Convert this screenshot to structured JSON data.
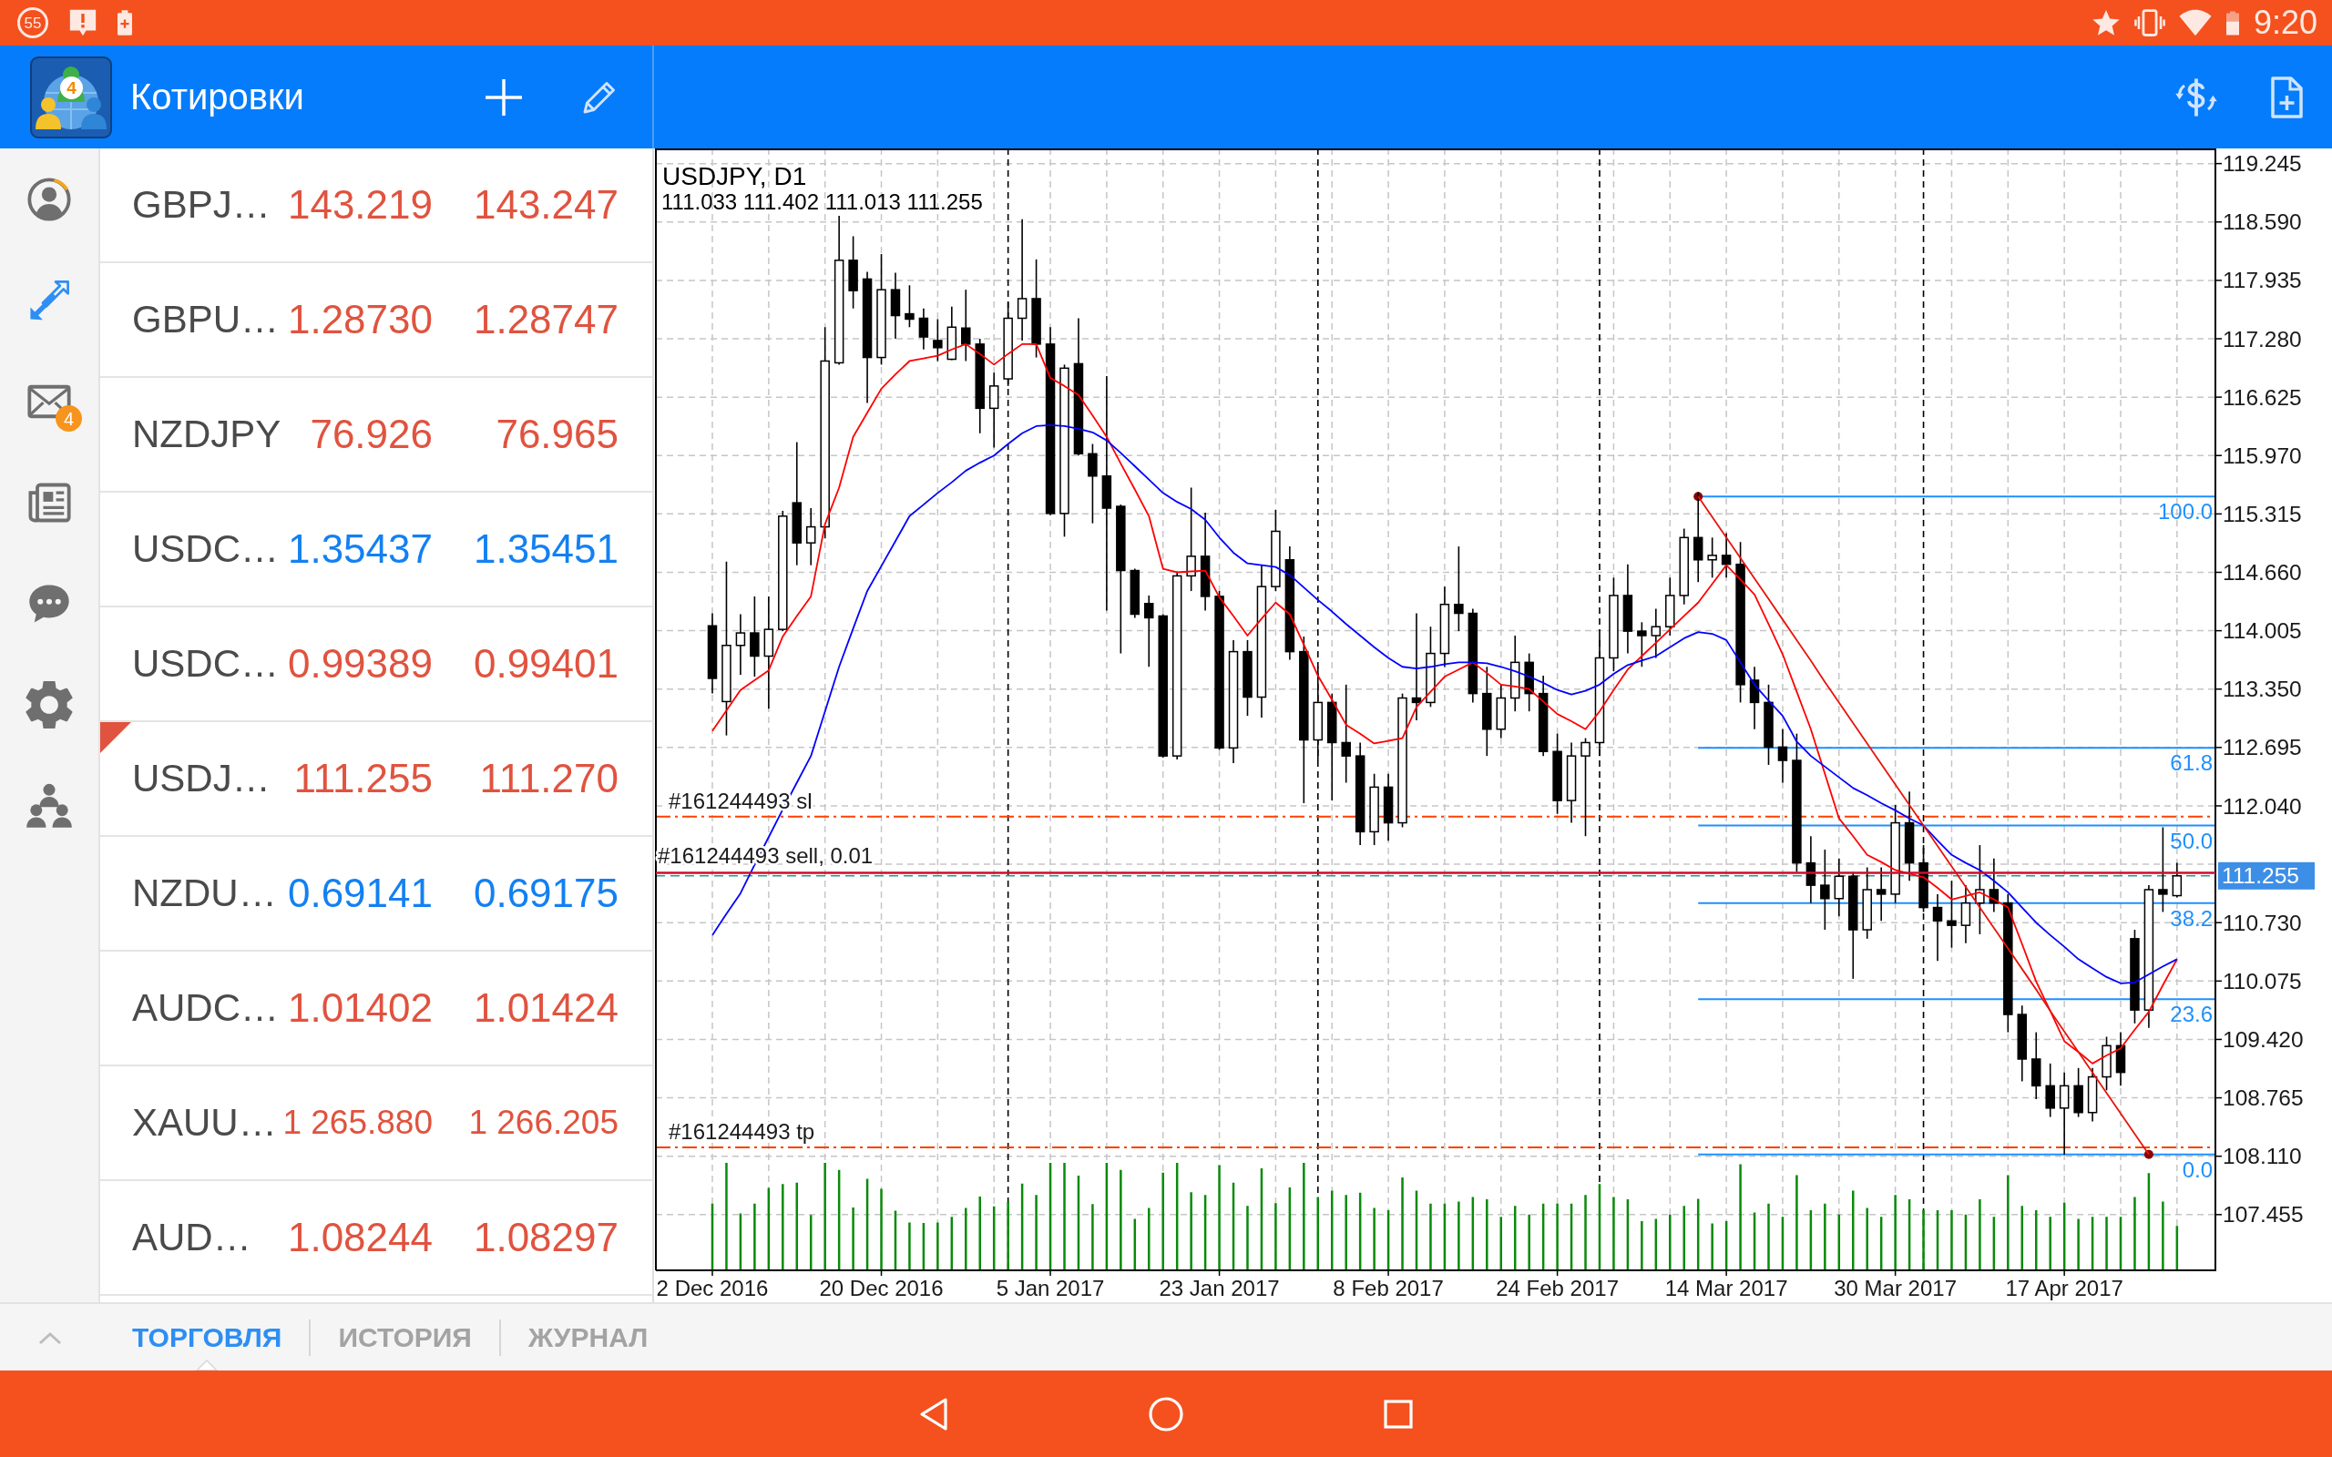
{
  "status_bar": {
    "notification_count": "55",
    "time": "9:20"
  },
  "app_bar": {
    "logo_badge": "4",
    "title": "Котировки"
  },
  "sidebar": {
    "items": [
      {
        "selected": false
      },
      {
        "selected": true
      },
      {
        "selected": false,
        "badge": "4"
      },
      {
        "selected": false
      },
      {
        "selected": false
      },
      {
        "selected": false
      },
      {
        "selected": false
      }
    ]
  },
  "quotes": [
    {
      "symbol": "GBPJ…",
      "bid": "143.219",
      "ask": "143.247",
      "color": "#e0533f",
      "selected": false
    },
    {
      "symbol": "GBPU…",
      "bid": "1.28730",
      "ask": "1.28747",
      "color": "#e0533f",
      "selected": false
    },
    {
      "symbol": "NZDJPY",
      "bid": "76.926",
      "ask": "76.965",
      "color": "#e0533f",
      "selected": false
    },
    {
      "symbol": "USDC…",
      "bid": "1.35437",
      "ask": "1.35451",
      "color": "#1380f2",
      "selected": false
    },
    {
      "symbol": "USDC…",
      "bid": "0.99389",
      "ask": "0.99401",
      "color": "#e0533f",
      "selected": false
    },
    {
      "symbol": "USDJ…",
      "bid": "111.255",
      "ask": "111.270",
      "color": "#e0533f",
      "selected": true
    },
    {
      "symbol": "NZDU…",
      "bid": "0.69141",
      "ask": "0.69175",
      "color": "#1380f2",
      "selected": false
    },
    {
      "symbol": "AUDC…",
      "bid": "1.01402",
      "ask": "1.01424",
      "color": "#e0533f",
      "selected": false
    },
    {
      "symbol": "XAUU…",
      "bid": "1 265.880",
      "ask": "1 266.205",
      "color": "#e0533f",
      "selected": false
    },
    {
      "symbol": "AUD…",
      "bid": "1.08244",
      "ask": "1.08297",
      "color": "#e0533f",
      "selected": false
    }
  ],
  "chart": {
    "chart_data": [
      {
        "type": "candlestick",
        "title": "USDJPY, D1",
        "subtitle": "111.033 111.402 111.013 111.255",
        "categories": [
          "2 Dec 2016",
          null,
          null,
          null,
          null,
          null,
          null,
          null,
          null,
          null,
          null,
          null,
          "20 Dec 2016",
          null,
          null,
          null,
          null,
          null,
          null,
          null,
          null,
          null,
          null,
          null,
          "5 Jan 2017",
          null,
          null,
          null,
          null,
          null,
          null,
          null,
          null,
          null,
          null,
          null,
          "23 Jan 2017",
          null,
          null,
          null,
          null,
          null,
          null,
          null,
          null,
          null,
          null,
          null,
          "8 Feb 2017",
          null,
          null,
          null,
          null,
          null,
          null,
          null,
          null,
          null,
          null,
          null,
          "24 Feb 2017",
          null,
          null,
          null,
          null,
          null,
          null,
          null,
          null,
          null,
          null,
          null,
          "14 Mar 2017",
          null,
          null,
          null,
          null,
          null,
          null,
          null,
          null,
          null,
          null,
          null,
          "30 Mar 2017",
          null,
          null,
          null,
          null,
          null,
          null,
          null,
          null,
          null,
          null,
          null,
          "17 Apr 2017",
          null,
          null,
          null,
          null,
          null,
          null,
          null,
          null,
          null,
          null
        ],
        "ohlc": [
          [
            114.06,
            114.2,
            113.3,
            113.47
          ],
          [
            113.21,
            114.78,
            112.83,
            113.84
          ],
          [
            113.84,
            114.19,
            113.51,
            113.98
          ],
          [
            113.98,
            114.39,
            113.49,
            113.72
          ],
          [
            113.72,
            114.39,
            113.13,
            114.02
          ],
          [
            114.02,
            115.35,
            114.0,
            115.29
          ],
          [
            115.44,
            116.12,
            114.74,
            114.99
          ],
          [
            114.99,
            115.38,
            114.74,
            115.17
          ],
          [
            115.17,
            117.41,
            115.04,
            117.03
          ],
          [
            117.01,
            118.66,
            116.99,
            118.16
          ],
          [
            118.16,
            118.43,
            117.62,
            117.82
          ],
          [
            117.95,
            118.03,
            116.56,
            117.07
          ],
          [
            117.07,
            118.23,
            116.99,
            117.83
          ],
          [
            117.83,
            118.02,
            117.28,
            117.54
          ],
          [
            117.56,
            117.88,
            117.41,
            117.5
          ],
          [
            117.51,
            117.62,
            117.16,
            117.3
          ],
          [
            117.26,
            117.5,
            117.03,
            117.18
          ],
          [
            117.05,
            117.64,
            117.04,
            117.41
          ],
          [
            117.4,
            117.83,
            117.03,
            117.22
          ],
          [
            117.22,
            117.28,
            116.22,
            116.5
          ],
          [
            116.5,
            116.9,
            116.06,
            116.75
          ],
          [
            116.83,
            117.69,
            116.75,
            117.51
          ],
          [
            117.51,
            118.62,
            117.26,
            117.73
          ],
          [
            117.73,
            118.17,
            117.07,
            117.22
          ],
          [
            117.22,
            117.41,
            115.3,
            115.32
          ],
          [
            115.32,
            116.99,
            115.06,
            116.95
          ],
          [
            117.0,
            117.51,
            115.97,
            115.99
          ],
          [
            115.99,
            116.1,
            115.21,
            115.74
          ],
          [
            115.74,
            116.86,
            114.23,
            115.38
          ],
          [
            115.4,
            115.42,
            113.75,
            114.68
          ],
          [
            114.68,
            114.7,
            114.15,
            114.19
          ],
          [
            114.31,
            114.4,
            113.6,
            114.15
          ],
          [
            114.17,
            114.19,
            112.58,
            112.6
          ],
          [
            112.6,
            114.67,
            112.56,
            114.62
          ],
          [
            114.62,
            115.61,
            114.45,
            114.84
          ],
          [
            114.84,
            115.33,
            114.23,
            114.39
          ],
          [
            114.39,
            114.45,
            112.67,
            112.69
          ],
          [
            112.69,
            113.9,
            112.52,
            113.77
          ],
          [
            113.77,
            113.9,
            113.05,
            113.26
          ],
          [
            113.26,
            114.74,
            113.03,
            114.5
          ],
          [
            114.5,
            115.36,
            114.45,
            115.12
          ],
          [
            114.8,
            114.95,
            113.68,
            113.77
          ],
          [
            113.77,
            113.94,
            112.07,
            112.78
          ],
          [
            112.78,
            113.6,
            112.55,
            113.2
          ],
          [
            113.2,
            113.3,
            112.1,
            112.75
          ],
          [
            112.75,
            113.4,
            112.3,
            112.6
          ],
          [
            112.6,
            112.75,
            111.6,
            111.75
          ],
          [
            111.75,
            112.4,
            111.6,
            112.25
          ],
          [
            112.25,
            112.4,
            111.65,
            111.85
          ],
          [
            111.85,
            113.3,
            111.8,
            113.25
          ],
          [
            113.25,
            114.2,
            113.0,
            113.2
          ],
          [
            113.2,
            114.05,
            113.15,
            113.75
          ],
          [
            113.75,
            114.5,
            113.6,
            114.3
          ],
          [
            114.3,
            114.95,
            114.0,
            114.2
          ],
          [
            114.2,
            114.25,
            113.2,
            113.3
          ],
          [
            113.3,
            113.6,
            112.6,
            112.9
          ],
          [
            112.9,
            113.4,
            112.8,
            113.25
          ],
          [
            113.25,
            113.95,
            113.1,
            113.65
          ],
          [
            113.65,
            113.75,
            113.1,
            113.3
          ],
          [
            113.3,
            113.5,
            112.6,
            112.65
          ],
          [
            112.65,
            112.85,
            111.95,
            112.1
          ],
          [
            112.1,
            112.75,
            111.85,
            112.6
          ],
          [
            112.6,
            112.8,
            111.7,
            112.75
          ],
          [
            112.75,
            113.95,
            112.6,
            113.7
          ],
          [
            113.7,
            114.6,
            113.55,
            114.4
          ],
          [
            114.4,
            114.75,
            113.75,
            114.0
          ],
          [
            114.0,
            114.1,
            113.6,
            113.95
          ],
          [
            113.95,
            114.25,
            113.7,
            114.05
          ],
          [
            114.05,
            114.6,
            113.95,
            114.4
          ],
          [
            114.4,
            115.15,
            114.3,
            115.05
          ],
          [
            115.05,
            115.56,
            114.55,
            114.8
          ],
          [
            114.8,
            115.05,
            114.6,
            114.85
          ],
          [
            114.85,
            115.1,
            114.6,
            114.75
          ],
          [
            114.75,
            115.0,
            113.2,
            113.4
          ],
          [
            113.45,
            113.6,
            112.9,
            113.2
          ],
          [
            113.2,
            113.4,
            112.5,
            112.7
          ],
          [
            112.7,
            112.9,
            112.3,
            112.55
          ],
          [
            112.55,
            112.85,
            111.3,
            111.4
          ],
          [
            111.4,
            111.7,
            110.95,
            111.15
          ],
          [
            111.15,
            111.55,
            110.65,
            111.0
          ],
          [
            111.0,
            111.45,
            110.8,
            111.25
          ],
          [
            111.25,
            111.3,
            110.1,
            110.65
          ],
          [
            110.65,
            111.35,
            110.55,
            111.1
          ],
          [
            111.1,
            111.35,
            110.75,
            111.05
          ],
          [
            111.05,
            112.05,
            110.95,
            111.85
          ],
          [
            111.85,
            112.2,
            111.2,
            111.4
          ],
          [
            111.4,
            111.6,
            110.85,
            110.9
          ],
          [
            110.9,
            111.05,
            110.3,
            110.75
          ],
          [
            110.75,
            111.2,
            110.45,
            110.7
          ],
          [
            110.7,
            111.15,
            110.5,
            110.95
          ],
          [
            110.95,
            111.6,
            110.6,
            111.1
          ],
          [
            111.1,
            111.45,
            110.85,
            110.95
          ],
          [
            110.95,
            111.05,
            109.5,
            109.7
          ],
          [
            109.7,
            109.8,
            108.95,
            109.2
          ],
          [
            109.2,
            109.5,
            108.75,
            108.9
          ],
          [
            108.9,
            109.15,
            108.55,
            108.65
          ],
          [
            108.65,
            109.05,
            108.13,
            108.9
          ],
          [
            108.9,
            109.1,
            108.55,
            108.6
          ],
          [
            108.6,
            109.1,
            108.5,
            109.0
          ],
          [
            109.0,
            109.45,
            108.85,
            109.35
          ],
          [
            109.35,
            109.5,
            108.9,
            109.05
          ],
          [
            110.55,
            110.65,
            109.6,
            109.75
          ],
          [
            109.75,
            111.15,
            109.55,
            111.1
          ],
          [
            111.1,
            111.8,
            110.85,
            111.05
          ],
          [
            111.033,
            111.402,
            111.013,
            111.255
          ],
          null,
          null
        ],
        "series": [
          {
            "type": "line",
            "color": "#ff0000",
            "values": [
              112.88,
              113.11,
              113.34,
              113.45,
              113.56,
              113.94,
              114.17,
              114.39,
              115.2,
              115.61,
              116.18,
              116.45,
              116.72,
              116.88,
              117.03,
              117.06,
              117.09,
              117.16,
              117.22,
              117.11,
              116.99,
              117.11,
              117.22,
              117.22,
              116.84,
              116.75,
              116.65,
              116.42,
              116.18,
              115.88,
              115.59,
              115.29,
              114.7,
              114.66,
              114.67,
              114.68,
              114.38,
              114.17,
              113.95,
              114.14,
              114.32,
              114.19,
              113.85,
              113.5,
              113.23,
              112.95,
              112.85,
              112.74,
              112.77,
              112.8,
              113.15,
              113.32,
              113.49,
              113.57,
              113.65,
              113.53,
              113.4,
              113.38,
              113.35,
              113.21,
              113.07,
              112.99,
              112.9,
              113.1,
              113.34,
              113.57,
              113.72,
              113.87,
              114.02,
              114.17,
              114.32,
              114.53,
              114.74,
              114.58,
              114.41,
              114.08,
              113.74,
              113.32,
              112.9,
              112.4,
              111.9,
              111.7,
              111.49,
              111.41,
              111.32,
              111.28,
              111.24,
              111.12,
              110.99,
              111.03,
              111.07,
              110.99,
              110.9,
              110.49,
              110.07,
              109.74,
              109.4,
              109.28,
              109.15,
              109.24,
              109.32,
              109.53,
              109.73,
              110.03,
              110.32,
              null,
              null
            ]
          },
          {
            "type": "line",
            "color": "#0000ff",
            "values": [
              110.59,
              110.83,
              111.06,
              111.38,
              111.69,
              112.0,
              112.3,
              112.6,
              113.1,
              113.6,
              114.03,
              114.45,
              114.73,
              115.01,
              115.29,
              115.42,
              115.55,
              115.67,
              115.8,
              115.89,
              115.97,
              116.1,
              116.22,
              116.3,
              116.31,
              116.3,
              116.27,
              116.23,
              116.14,
              116.0,
              115.85,
              115.7,
              115.55,
              115.45,
              115.37,
              115.25,
              115.05,
              114.88,
              114.76,
              114.74,
              114.72,
              114.63,
              114.49,
              114.35,
              114.22,
              114.08,
              113.95,
              113.82,
              113.7,
              113.6,
              113.58,
              113.6,
              113.63,
              113.65,
              113.65,
              113.64,
              113.6,
              113.55,
              113.49,
              113.42,
              113.34,
              113.29,
              113.33,
              113.4,
              113.52,
              113.62,
              113.67,
              113.72,
              113.82,
              113.92,
              113.99,
              113.97,
              113.9,
              113.65,
              113.4,
              113.22,
              113.05,
              112.76,
              112.6,
              112.48,
              112.36,
              112.24,
              112.16,
              112.07,
              111.99,
              111.9,
              111.82,
              111.65,
              111.49,
              111.4,
              111.32,
              111.2,
              111.07,
              110.9,
              110.73,
              110.59,
              110.46,
              110.32,
              110.22,
              110.12,
              110.05,
              110.06,
              110.15,
              110.24,
              110.32,
              null,
              null
            ]
          },
          {
            "type": "line",
            "color": "#e8140c",
            "values": [
              null,
              null,
              null,
              null,
              null,
              null,
              null,
              null,
              null,
              null,
              null,
              null,
              null,
              null,
              null,
              null,
              null,
              null,
              null,
              null,
              null,
              null,
              null,
              null,
              null,
              null,
              null,
              null,
              null,
              null,
              null,
              null,
              null,
              null,
              null,
              null,
              null,
              null,
              null,
              null,
              null,
              null,
              null,
              null,
              null,
              null,
              null,
              null,
              null,
              null,
              null,
              null,
              null,
              null,
              null,
              null,
              null,
              null,
              null,
              null,
              null,
              null,
              null,
              null,
              null,
              null,
              null,
              null,
              null,
              null,
              115.51,
              115.28,
              115.05,
              114.82,
              114.59,
              114.36,
              114.13,
              113.9,
              113.67,
              113.43,
              113.2,
              112.97,
              112.74,
              112.51,
              112.28,
              112.05,
              111.82,
              111.59,
              111.36,
              111.13,
              110.9,
              110.67,
              110.44,
              110.21,
              109.98,
              109.74,
              109.51,
              109.28,
              109.05,
              108.82,
              108.59,
              108.36,
              108.13,
              null,
              null,
              null,
              null
            ]
          },
          {
            "type": "scatter",
            "color": "#8a0000",
            "values": [
              null,
              null,
              null,
              null,
              null,
              null,
              null,
              null,
              null,
              null,
              null,
              null,
              null,
              null,
              null,
              null,
              null,
              null,
              null,
              null,
              null,
              null,
              null,
              null,
              null,
              null,
              null,
              null,
              null,
              null,
              null,
              null,
              null,
              null,
              null,
              null,
              null,
              null,
              null,
              null,
              null,
              null,
              null,
              null,
              null,
              null,
              null,
              null,
              null,
              null,
              null,
              null,
              null,
              null,
              null,
              null,
              null,
              null,
              null,
              null,
              null,
              null,
              null,
              null,
              null,
              null,
              null,
              null,
              null,
              null,
              115.51,
              null,
              null,
              null,
              null,
              null,
              null,
              null,
              null,
              null,
              null,
              null,
              null,
              null,
              null,
              null,
              null,
              null,
              null,
              null,
              null,
              null,
              null,
              null,
              null,
              null,
              null,
              null,
              null,
              null,
              null,
              null,
              108.13,
              null,
              null,
              null,
              null
            ]
          }
        ],
        "ylim": [
          106.83,
          119.415
        ],
        "yticks": [
          107.455,
          {
            "value": 108.11,
            "label": "108.110"
          },
          108.765,
          {
            "value": 109.42,
            "label": "109.420"
          },
          110.075,
          {
            "value": 110.73,
            "label": "110.730"
          },
          {
            "value": 112.04,
            "label": "112.040"
          },
          112.695,
          {
            "value": 113.35,
            "label": "113.350"
          },
          114.005,
          {
            "value": 114.66,
            "label": "114.660"
          },
          115.315,
          {
            "value": 115.97,
            "label": "115.970"
          },
          116.625,
          {
            "value": 117.28,
            "label": "117.280"
          },
          117.935,
          {
            "value": 118.59,
            "label": "118.590"
          },
          119.245
        ],
        "grid": true,
        "ref_lines": [
          {
            "axis": "y",
            "value": 111.92,
            "label": "#161244493 sl",
            "color": "#ff4000",
            "line_style": "dashdot"
          },
          {
            "axis": "y",
            "value": 111.29,
            "label": "#161244493 sell, 0.01",
            "color": "#c8102e",
            "line_style": "solid"
          },
          {
            "axis": "y",
            "value": 111.255,
            "label": "111.255",
            "color": "#1f9e89",
            "line_style": "dashed"
          },
          {
            "axis": "y",
            "value": 108.21,
            "label": "#161244493 tp",
            "color": "#ff4000",
            "line_style": "dashdot"
          }
        ]
      }
    ],
    "fibonacci_levels": [
      "100.0",
      "61.8",
      "50.0",
      "38.2",
      "23.6",
      "0.0"
    ]
  },
  "bottom_tabs": [
    {
      "label": "ТОРГОВЛЯ",
      "selected": true
    },
    {
      "label": "ИСТОРИЯ",
      "selected": false
    },
    {
      "label": "ЖУРНАЛ",
      "selected": false
    }
  ]
}
